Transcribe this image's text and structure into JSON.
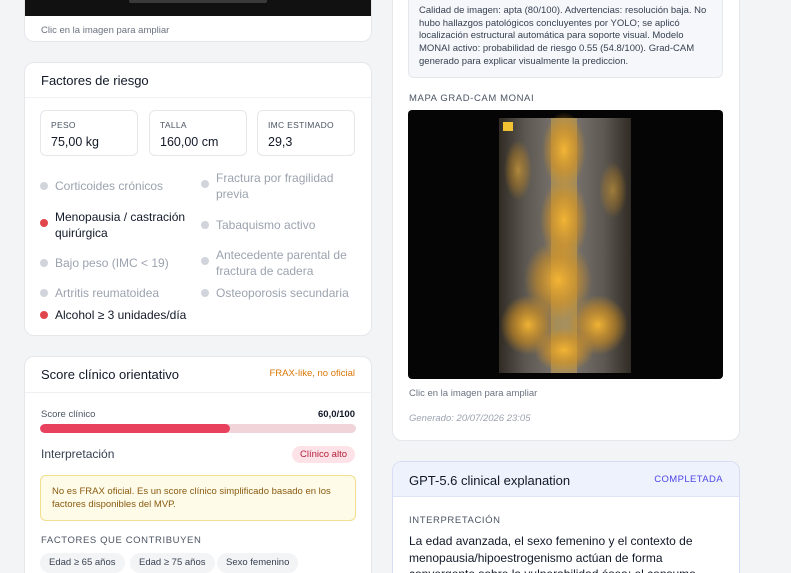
{
  "top_image_card": {
    "caption": "Clic en la imagen para ampliar"
  },
  "risk_factors": {
    "title": "Factores de riesgo",
    "metrics": [
      {
        "label": "PESO",
        "value": "75,00 kg"
      },
      {
        "label": "TALLA",
        "value": "160,00 cm"
      },
      {
        "label": "IMC ESTIMADO",
        "value": "29,3"
      }
    ],
    "items": [
      {
        "label": "Corticoides crónicos",
        "active": false
      },
      {
        "label": "Fractura por fragilidad previa",
        "active": false
      },
      {
        "label": "Menopausia / castración quirúrgica",
        "active": true
      },
      {
        "label": "Tabaquismo activo",
        "active": false
      },
      {
        "label": "Bajo peso (IMC < 19)",
        "active": false
      },
      {
        "label": "Antecedente parental de fractura de cadera",
        "active": false
      },
      {
        "label": "Artritis reumatoidea",
        "active": false
      },
      {
        "label": "Osteoporosis secundaria",
        "active": false
      },
      {
        "label": "Alcohol ≥ 3 unidades/día",
        "active": true
      }
    ]
  },
  "clinical_score": {
    "title": "Score clínico orientativo",
    "tag": "FRAX-like, no oficial",
    "score_label": "Score clínico",
    "score_text": "60,0/100",
    "score_fraction": 0.6,
    "interpretation_label": "Interpretación",
    "interpretation_badge": "Clínico alto",
    "disclaimer": "No es FRAX oficial. Es un score clínico simplificado basado en los factores disponibles del MVP.",
    "contributors_title": "FACTORES QUE CONTRIBUYEN",
    "contributors": [
      "Edad ≥ 65 años",
      "Edad ≥ 75 años",
      "Sexo femenino"
    ]
  },
  "analysis": {
    "quality_note": "Calidad de imagen: apta (80/100). Advertencias: resolución baja. No hubo hallazgos patológicos concluyentes por YOLO; se aplicó localización estructural automática para soporte visual. Modelo MONAI activo: probabilidad de riesgo 0.55 (54.8/100). Grad-CAM generado para explicar visualmente la prediccion.",
    "map_title": "MAPA GRAD-CAM MONAI",
    "map_caption": "Clic en la imagen para ampliar",
    "generated": "Generado: 20/07/2026 23:05"
  },
  "gpt": {
    "title": "GPT-5.6 clinical explanation",
    "status": "COMPLETADA",
    "section": "INTERPRETACIÓN",
    "body": "La edad avanzada, el sexo femenino y el contexto de menopausia/hipoestrogenismo actúan de forma convergente sobre la vulnerabilidad ósea; el consumo elevado de alcohol"
  },
  "colors": {
    "accent_red": "#e0464b",
    "warning_orange": "#d97706",
    "status_indigo": "#4f46e5"
  }
}
